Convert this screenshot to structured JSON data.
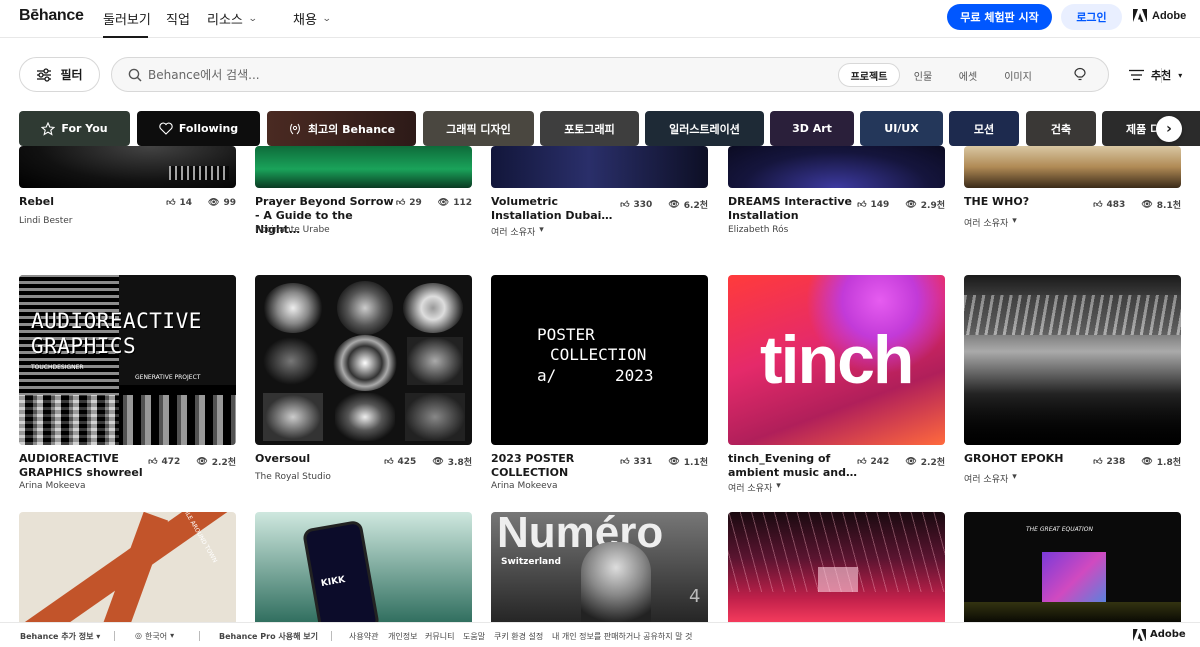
{
  "topnav": {
    "logo": "Bēhance",
    "items": [
      {
        "label": "둘러보기",
        "active": true
      },
      {
        "label": "직업"
      },
      {
        "label": "리소스"
      },
      {
        "label": "채용"
      }
    ],
    "trial_button": "무료 체험판 시작",
    "login_button": "로그인",
    "adobe": "Adobe"
  },
  "search": {
    "filter_label": "필터",
    "placeholder": "Behance에서 검색...",
    "segments": [
      {
        "label": "프로젝트",
        "active": true
      },
      {
        "label": "인물"
      },
      {
        "label": "에셋"
      },
      {
        "label": "이미지"
      }
    ],
    "sort_label": "추천"
  },
  "chips": [
    {
      "label": "For You",
      "icon": "star-icon",
      "color": "#2f3a33"
    },
    {
      "label": "Following",
      "icon": "heart-icon",
      "color": "#0d0d0d"
    },
    {
      "label": "최고의 Behance",
      "icon": "laurel-icon",
      "color": "#3a2420"
    },
    {
      "label": "그래픽 디자인",
      "color": "#4a4740"
    },
    {
      "label": "포토그래피",
      "color": "#3e3e3e"
    },
    {
      "label": "일러스트레이션",
      "color": "#1e2a36"
    },
    {
      "label": "3D Art",
      "color": "#2a1f3a"
    },
    {
      "label": "UI/UX",
      "color": "#24375a"
    },
    {
      "label": "모션",
      "color": "#1d2a4e"
    },
    {
      "label": "건축",
      "color": "#3a3836"
    },
    {
      "label": "제품 디자인",
      "color": "#2b2b2b"
    }
  ],
  "projects": [
    {
      "title": "Rebel",
      "owner": "Lindi Bester",
      "likes": "14",
      "views": "99"
    },
    {
      "title": "Prayer Beyond Sorrow - A Guide to the Night…",
      "owner": "Rocinante Urabe",
      "likes": "29",
      "views": "112"
    },
    {
      "title": "Volumetric Installation Dubai…",
      "owner": "여러 소유자",
      "multi_owner": true,
      "likes": "330",
      "views": "6.2천"
    },
    {
      "title": "DREAMS Interactive Installation",
      "owner": "Elizabeth Rós",
      "likes": "149",
      "views": "2.9천"
    },
    {
      "title": "THE WHO?",
      "owner": "여러 소유자",
      "multi_owner": true,
      "likes": "483",
      "views": "8.1천"
    },
    {
      "title": "AUDIOREACTIVE GRAPHICS showreel",
      "owner": "Arina Mokeeva",
      "likes": "472",
      "views": "2.2천",
      "art": {
        "line1": "AUDIOREACTIVE",
        "line2": "GRAPHICS",
        "tag1": "TOUCHDESIGNER",
        "tag2": "GENERATIVE PROJECT"
      }
    },
    {
      "title": "Oversoul",
      "owner": "The Royal Studio",
      "likes": "425",
      "views": "3.8천"
    },
    {
      "title": "2023 POSTER COLLECTION",
      "owner": "Arina Mokeeva",
      "likes": "331",
      "views": "1.1천",
      "art": {
        "line1": "POSTER",
        "line2": "COLLECTION",
        "a": "a/",
        "year": "2023"
      }
    },
    {
      "title": "tinch_Evening of ambient music and…",
      "owner": "여러 소유자",
      "multi_owner": true,
      "likes": "242",
      "views": "2.2천",
      "art": {
        "word": "tinch"
      }
    },
    {
      "title": "GROHOT EPOKH",
      "owner": "여러 소유자",
      "multi_owner": true,
      "likes": "238",
      "views": "1.8천"
    },
    {
      "title": "",
      "owner": "",
      "art": {
        "text": "TILE AROUND TOWN"
      }
    },
    {
      "title": "",
      "owner": "",
      "art": {
        "text": "KIKK"
      }
    },
    {
      "title": "",
      "owner": "",
      "art": {
        "word": "Numéro",
        "sub": "Switzerland",
        "num": "4"
      }
    },
    {
      "title": "",
      "owner": ""
    },
    {
      "title": "",
      "owner": "",
      "art": {
        "text": "THE GREAT EQUATION"
      }
    }
  ],
  "footer": {
    "more_info": "Behance 추가 정보",
    "language": "한국어",
    "pro": "Behance Pro 사용해 보기",
    "links": [
      "사용약관",
      "개인정보",
      "커뮤니티",
      "도움말",
      "쿠키 환경 설정",
      "내 개인 정보를 판매하거나 공유하지 말 것"
    ],
    "adobe": "Adobe"
  },
  "colors": {
    "accent": "#0057ff",
    "accent_light": "#e9efff",
    "text": "#191919"
  }
}
